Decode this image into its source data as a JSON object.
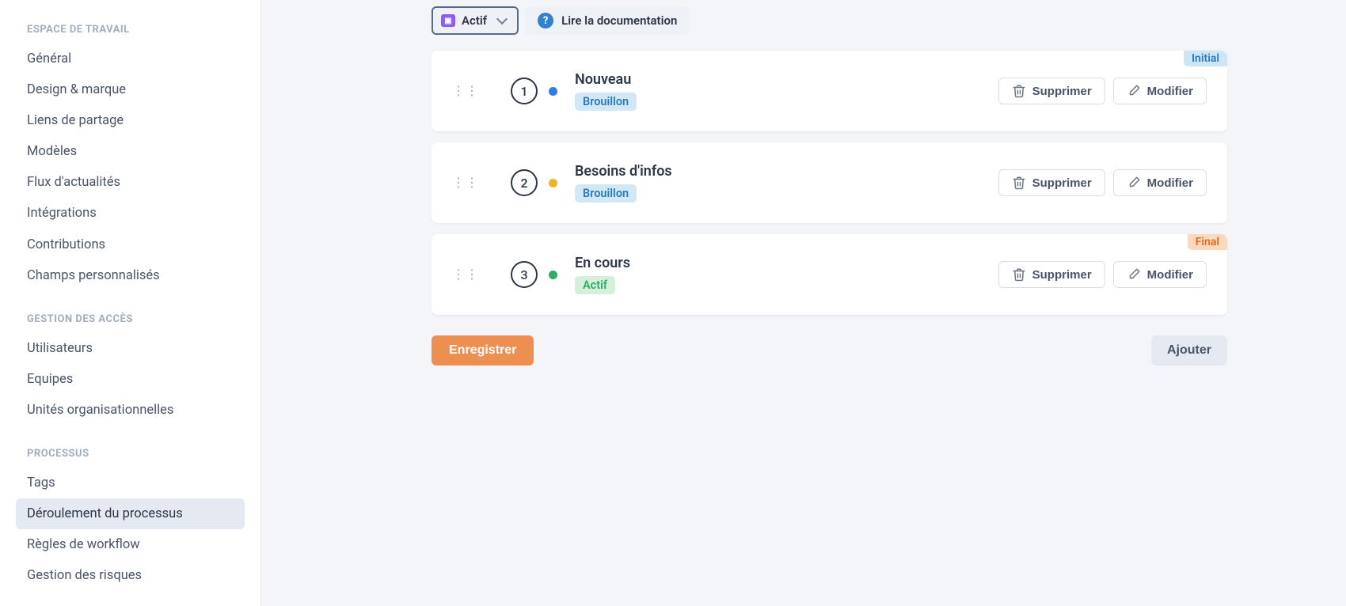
{
  "sidebar": {
    "sections": [
      {
        "title": "ESPACE DE TRAVAIL",
        "items": [
          {
            "label": "Général",
            "active": false
          },
          {
            "label": "Design & marque",
            "active": false
          },
          {
            "label": "Liens de partage",
            "active": false
          },
          {
            "label": "Modèles",
            "active": false
          },
          {
            "label": "Flux d'actualités",
            "active": false
          },
          {
            "label": "Intégrations",
            "active": false
          },
          {
            "label": "Contributions",
            "active": false
          },
          {
            "label": "Champs personnalisés",
            "active": false
          }
        ]
      },
      {
        "title": "GESTION DES ACCÈS",
        "items": [
          {
            "label": "Utilisateurs",
            "active": false
          },
          {
            "label": "Equipes",
            "active": false
          },
          {
            "label": "Unités organisationnelles",
            "active": false
          }
        ]
      },
      {
        "title": "PROCESSUS",
        "items": [
          {
            "label": "Tags",
            "active": false
          },
          {
            "label": "Déroulement du processus",
            "active": true
          },
          {
            "label": "Règles de workflow",
            "active": false
          },
          {
            "label": "Gestion des risques",
            "active": false
          }
        ]
      }
    ]
  },
  "toolbar": {
    "status_label": "Actif",
    "doc_link_label": "Lire la documentation"
  },
  "steps": [
    {
      "number": "1",
      "dot_class": "dot-blue",
      "title": "Nouveau",
      "pill_text": "Brouillon",
      "pill_class": "pill-brouillon",
      "corner": "Initial",
      "corner_class": "badge-initial"
    },
    {
      "number": "2",
      "dot_class": "dot-yellow",
      "title": "Besoins d'infos",
      "pill_text": "Brouillon",
      "pill_class": "pill-brouillon",
      "corner": null,
      "corner_class": null
    },
    {
      "number": "3",
      "dot_class": "dot-green",
      "title": "En cours",
      "pill_text": "Actif",
      "pill_class": "pill-actif",
      "corner": "Final",
      "corner_class": "badge-final"
    }
  ],
  "buttons": {
    "delete": "Supprimer",
    "edit": "Modifier",
    "save": "Enregistrer",
    "add": "Ajouter"
  }
}
